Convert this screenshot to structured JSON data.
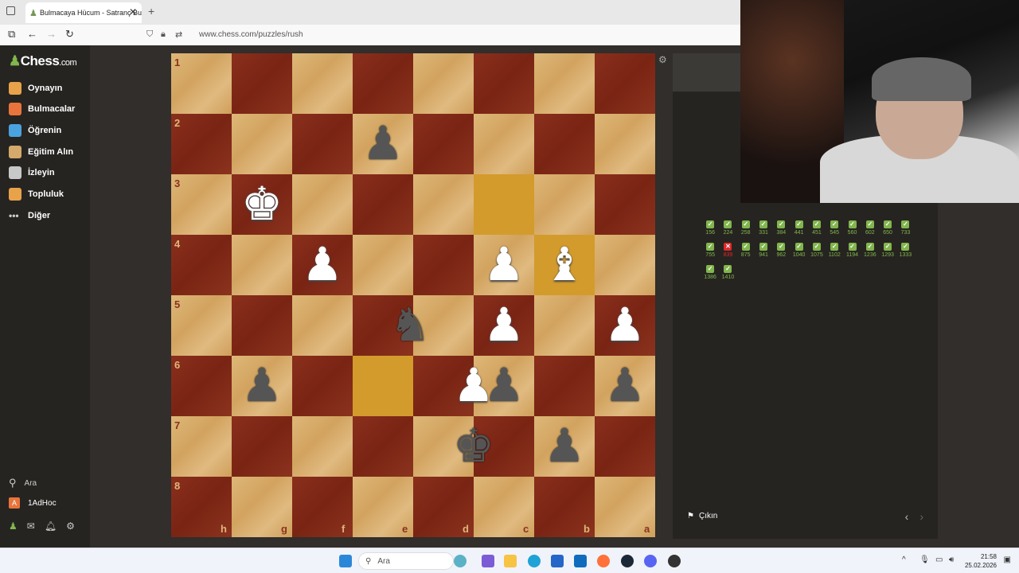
{
  "browser": {
    "tab_title": "Bulmacaya Hücum - Satranç Bu",
    "url": "www.chess.com/puzzles/rush"
  },
  "sidebar": {
    "logo": "Chess",
    "logo_suffix": ".com",
    "items": [
      {
        "label": "Oynayın",
        "icon": "play-icon",
        "color": "#e8a24a"
      },
      {
        "label": "Bulmacalar",
        "icon": "puzzle-icon",
        "color": "#e8743b"
      },
      {
        "label": "Öğrenin",
        "icon": "learn-icon",
        "color": "#4aa3df"
      },
      {
        "label": "Eğitim Alın",
        "icon": "train-icon",
        "color": "#d5a86b"
      },
      {
        "label": "İzleyin",
        "icon": "watch-icon",
        "color": "#c8c8c8"
      },
      {
        "label": "Topluluk",
        "icon": "community-icon",
        "color": "#e8a24a"
      },
      {
        "label": "Diğer",
        "icon": "more-icon",
        "color": "#cccccc"
      }
    ],
    "search_label": "Ara",
    "user_initial": "A",
    "username": "1AdHoc"
  },
  "board": {
    "ranks": [
      "1",
      "2",
      "3",
      "4",
      "5",
      "6",
      "7",
      "8"
    ],
    "files": [
      "h",
      "g",
      "f",
      "e",
      "d",
      "c",
      "b",
      "a"
    ],
    "highlight_squares": [
      [
        2,
        5
      ],
      [
        3,
        6
      ],
      [
        5,
        3
      ]
    ],
    "pieces": [
      {
        "row": 1,
        "col": 3,
        "glyph": "♟",
        "color": "black"
      },
      {
        "row": 2,
        "col": 1,
        "glyph": "♚",
        "color": "white"
      },
      {
        "row": 3,
        "col": 2,
        "glyph": "♟",
        "color": "white"
      },
      {
        "row": 3,
        "col": 5,
        "glyph": "♟",
        "color": "white"
      },
      {
        "row": 3,
        "col": 6,
        "glyph": "♝",
        "color": "white"
      },
      {
        "row": 4,
        "col": 5,
        "glyph": "♟",
        "color": "white"
      },
      {
        "row": 4,
        "col": 7,
        "glyph": "♟",
        "color": "white"
      },
      {
        "row": 4,
        "col": 3.45,
        "glyph": "♞",
        "color": "black"
      },
      {
        "row": 5,
        "col": 1,
        "glyph": "♟",
        "color": "black"
      },
      {
        "row": 5,
        "col": 4.5,
        "glyph": "♟",
        "color": "white"
      },
      {
        "row": 5,
        "col": 5,
        "glyph": "♟",
        "color": "black"
      },
      {
        "row": 5,
        "col": 7,
        "glyph": "♟",
        "color": "black"
      },
      {
        "row": 6,
        "col": 4.5,
        "glyph": "♚",
        "color": "black"
      },
      {
        "row": 6,
        "col": 6,
        "glyph": "♟",
        "color": "black"
      }
    ]
  },
  "panel": {
    "results": [
      {
        "ok": true,
        "num": "156"
      },
      {
        "ok": true,
        "num": "224"
      },
      {
        "ok": true,
        "num": "258"
      },
      {
        "ok": true,
        "num": "331"
      },
      {
        "ok": true,
        "num": "384"
      },
      {
        "ok": true,
        "num": "441"
      },
      {
        "ok": true,
        "num": "451"
      },
      {
        "ok": true,
        "num": "545"
      },
      {
        "ok": true,
        "num": "560"
      },
      {
        "ok": true,
        "num": "602"
      },
      {
        "ok": true,
        "num": "650"
      },
      {
        "ok": true,
        "num": "733"
      },
      {
        "ok": true,
        "num": "755"
      },
      {
        "ok": false,
        "num": "839"
      },
      {
        "ok": true,
        "num": "875"
      },
      {
        "ok": true,
        "num": "941"
      },
      {
        "ok": true,
        "num": "962"
      },
      {
        "ok": true,
        "num": "1040"
      },
      {
        "ok": true,
        "num": "1075"
      },
      {
        "ok": true,
        "num": "1102"
      },
      {
        "ok": true,
        "num": "1194"
      },
      {
        "ok": true,
        "num": "1236"
      },
      {
        "ok": true,
        "num": "1293"
      },
      {
        "ok": true,
        "num": "1333"
      },
      {
        "ok": true,
        "num": "1386"
      },
      {
        "ok": true,
        "num": "1410"
      }
    ],
    "exit_label": "Çıkın"
  },
  "taskbar": {
    "search_label": "Ara",
    "time": "21:58",
    "date": "25.02.2026"
  }
}
